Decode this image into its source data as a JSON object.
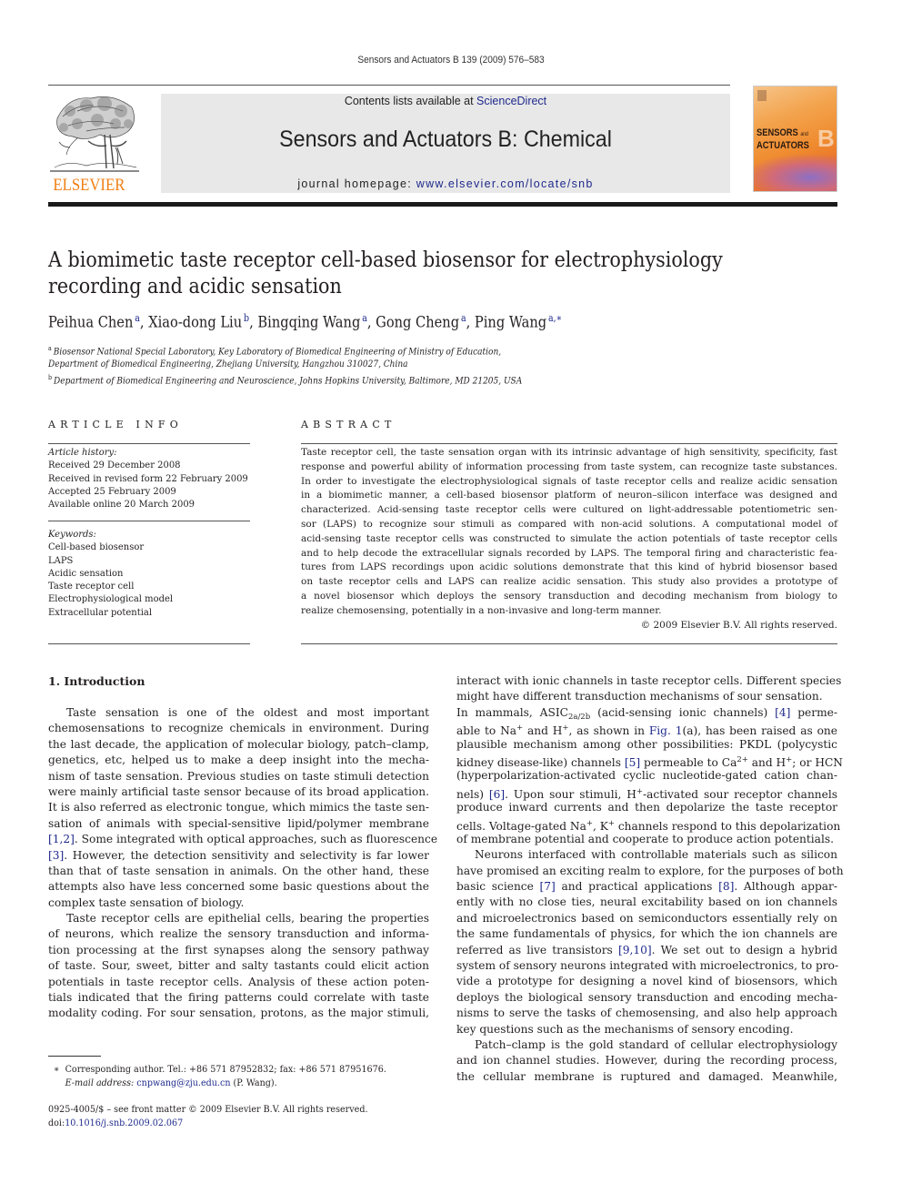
{
  "running_head": "Sensors and Actuators B 139 (2009) 576–583",
  "masthead": {
    "contents_prefix": "Contents lists available at ",
    "contents_link": "ScienceDirect",
    "journal_title": "Sensors and Actuators B: Chemical",
    "homepage_prefix": "journal homepage: ",
    "homepage_url": "www.elsevier.com/locate/snb",
    "publisher_logo": "ELSEVIER",
    "cover_title_line1": "SENSORS",
    "cover_title_and": "and",
    "cover_title_line2": "ACTUATORS",
    "cover_letter": "B"
  },
  "colors": {
    "elsevier_orange": "#f07f13",
    "link_blue": "#1f2a8c",
    "masthead_gray": "#e8e8e8"
  },
  "article": {
    "title_line1": "A biomimetic taste receptor cell-based biosensor for electrophysiology",
    "title_line2": "recording and acidic sensation",
    "authors": [
      {
        "name": "Peihua Chen",
        "aff": "a",
        "sep": ", "
      },
      {
        "name": "Xiao-dong Liu",
        "aff": "b",
        "sep": ", "
      },
      {
        "name": "Bingqing Wang",
        "aff": "a",
        "sep": ", "
      },
      {
        "name": "Gong Cheng",
        "aff": "a",
        "sep": ", "
      },
      {
        "name": "Ping Wang",
        "aff": "a,∗",
        "sep": ""
      }
    ],
    "affiliations": [
      {
        "mark": "a",
        "text": "Biosensor National Special Laboratory, Key Laboratory of Biomedical Engineering of Ministry of Education,"
      },
      {
        "mark": "",
        "text": "Department of Biomedical Engineering, Zhejiang University, Hangzhou 310027, China"
      },
      {
        "mark": "b",
        "text": "Department of Biomedical Engineering and Neuroscience, Johns Hopkins University, Baltimore, MD 21205, USA"
      }
    ]
  },
  "article_info": {
    "label": "ARTICLE INFO",
    "history_heading": "Article history:",
    "history": [
      "Received 29 December 2008",
      "Received in revised form 22 February 2009",
      "Accepted 25 February 2009",
      "Available online 20 March 2009"
    ],
    "keywords_heading": "Keywords:",
    "keywords": [
      "Cell-based biosensor",
      "LAPS",
      "Acidic sensation",
      "Taste receptor cell",
      "Electrophysiological model",
      "Extracellular potential"
    ]
  },
  "abstract": {
    "label": "ABSTRACT",
    "lines": [
      "Taste receptor cell, the taste sensation organ with its intrinsic advantage of high sensitivity, specificity, fast",
      "response and powerful ability of information processing from taste system, can recognize taste substances.",
      "In order to investigate the electrophysiological signals of taste receptor cells and realize acidic sensation",
      "in a biomimetic manner, a cell-based biosensor platform of neuron–silicon interface was designed and",
      "characterized. Acid-sensing taste receptor cells were cultured on light-addressable potentiometric sen-",
      "sor (LAPS) to recognize sour stimuli as compared with non-acid solutions. A computational model of",
      "acid-sensing taste receptor cells was constructed to simulate the action potentials of taste receptor cells",
      "and to help decode the extracellular signals recorded by LAPS. The temporal firing and characteristic fea-",
      "tures from LAPS recordings upon acidic solutions demonstrate that this kind of hybrid biosensor based",
      "on taste receptor cells and LAPS can realize acidic sensation. This study also provides a prototype of",
      "a novel biosensor which deploys the sensory transduction and decoding mechanism from biology to",
      "realize chemosensing, potentially in a non-invasive and long-term manner."
    ],
    "copyright": "© 2009 Elsevier B.V. All rights reserved."
  },
  "introduction": {
    "heading": "1.  Introduction",
    "left_column": [
      {
        "t": "Taste sensation is one of the oldest and most important",
        "ind": true
      },
      {
        "t": "chemosensations to recognize chemicals in environment. During"
      },
      {
        "t": "the last decade, the application of molecular biology, patch–clamp,"
      },
      {
        "t": "genetics, etc, helped us to make a deep insight into the mecha-"
      },
      {
        "t": "nism of taste sensation. Previous studies on taste stimuli detection"
      },
      {
        "t": "were mainly artificial taste sensor because of its broad application."
      },
      {
        "t": "It is also referred as electronic tongue, which mimics the taste sen-"
      },
      {
        "t": "sation of animals with special-sensitive lipid/polymer membrane"
      },
      {
        "pre": "",
        "ref": "[1,2]",
        "t": ". Some integrated with optical approaches, such as fluorescence"
      },
      {
        "pre": "",
        "ref": "[3]",
        "t": ". However, the detection sensitivity and selectivity is far lower"
      },
      {
        "t": "than that of taste sensation in animals. On the other hand, these"
      },
      {
        "t": "attempts also have less concerned some basic questions about the"
      },
      {
        "t": "complex taste sensation of biology.",
        "last": true
      },
      {
        "t": "Taste receptor cells are epithelial cells, bearing the properties",
        "ind": true
      },
      {
        "t": "of neurons, which realize the sensory transduction and informa-"
      },
      {
        "t": "tion processing at the first synapses along the sensory pathway"
      },
      {
        "t": "of taste. Sour, sweet, bitter and salty tastants could elicit action"
      },
      {
        "t": "potentials in taste receptor cells. Analysis of these action poten-"
      },
      {
        "t": "tials indicated that the firing patterns could correlate with taste"
      },
      {
        "t": "modality coding. For sour sensation, protons, as the major stimuli,"
      }
    ],
    "right_column": {
      "l1": "interact with ionic channels in taste receptor cells. Different species",
      "l2": "might have different transduction mechanisms of sour sensation.",
      "l3_a": "In mammals, ASIC",
      "l3_sub": "2a/2b",
      "l3_b": " (acid-sensing ionic channels) ",
      "l3_ref": "[4]",
      "l3_c": " perme-",
      "l4_a": "able to Na",
      "l4_sup1": "+",
      "l4_b": " and H",
      "l4_sup2": "+",
      "l4_c": ", as shown in ",
      "l4_ref": "Fig. 1",
      "l4_d": "(a), has been raised as one",
      "l5": "plausible mechanism among other possibilities: PKDL (polycystic",
      "l6_a": "kidney disease-like) channels ",
      "l6_ref": "[5]",
      "l6_b": " permeable to Ca",
      "l6_sup1": "2+",
      "l6_c": " and H",
      "l6_sup2": "+",
      "l6_d": "; or HCN",
      "l7": "(hyperpolarization-activated cyclic nucleotide-gated cation chan-",
      "l8_a": "nels) ",
      "l8_ref": "[6]",
      "l8_b": ". Upon sour stimuli, H",
      "l8_sup": "+",
      "l8_c": "-activated sour receptor channels",
      "l9": "produce inward currents and then depolarize the taste receptor",
      "l10_a": "cells. Voltage-gated Na",
      "l10_sup1": "+",
      "l10_b": ", K",
      "l10_sup2": "+",
      "l10_c": " channels respond to this depolarization",
      "l11": "of membrane potential and cooperate to produce action potentials.",
      "l12": "Neurons interfaced with controllable materials such as silicon",
      "l13": "have promised an exciting realm to explore, for the purposes of both",
      "l14_a": "basic science ",
      "l14_ref1": "[7]",
      "l14_b": " and practical applications ",
      "l14_ref2": "[8]",
      "l14_c": ". Although appar-",
      "l15": "ently with no close ties, neural excitability based on ion channels",
      "l16": "and microelectronics based on semiconductors essentially rely on",
      "l17": "the same fundamentals of physics, for which the ion channels are",
      "l18_a": "referred as live transistors ",
      "l18_ref": "[9,10]",
      "l18_b": ". We set out to design a hybrid",
      "l19": "system of sensory neurons integrated with microelectronics, to pro-",
      "l20": "vide a prototype for designing a novel kind of biosensors, which",
      "l21": "deploys the biological sensory transduction and encoding mecha-",
      "l22": "nisms to serve the tasks of chemosensing, and also help approach",
      "l23": "key questions such as the mechanisms of sensory encoding.",
      "l24": "Patch–clamp is the gold standard of cellular electrophysiology",
      "l25": "and ion channel studies. However, during the recording process,",
      "l26": "the cellular membrane is ruptured and damaged. Meanwhile,"
    }
  },
  "footnote": {
    "star": "∗",
    "corresponding": "Corresponding author. Tel.: +86 571 87952832; fax: +86 571 87951676.",
    "email_label": "E-mail address: ",
    "email": "cnpwang@zju.edu.cn",
    "email_suffix": " (P. Wang)."
  },
  "front_matter": {
    "issn_line": "0925-4005/$ – see front matter © 2009 Elsevier B.V. All rights reserved.",
    "doi_prefix": "doi:",
    "doi": "10.1016/j.snb.2009.02.067"
  }
}
